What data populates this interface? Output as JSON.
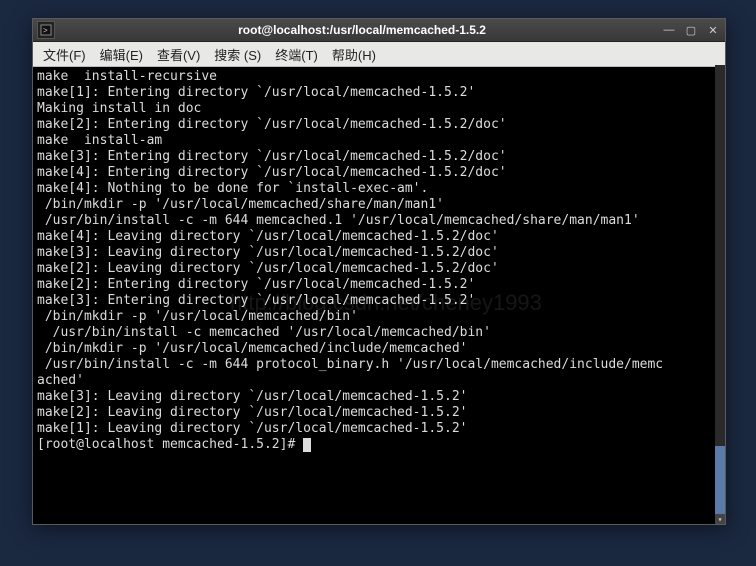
{
  "titlebar": {
    "title": "root@localhost:/usr/local/memcached-1.5.2"
  },
  "menubar": {
    "file": "文件(F)",
    "edit": "编辑(E)",
    "view": "查看(V)",
    "search": "搜索 (S)",
    "terminal": "终端(T)",
    "help": "帮助(H)"
  },
  "watermark": "http://blog.csdn.net/cheney1993",
  "terminal": {
    "lines": [
      "make  install-recursive",
      "make[1]: Entering directory `/usr/local/memcached-1.5.2'",
      "Making install in doc",
      "make[2]: Entering directory `/usr/local/memcached-1.5.2/doc'",
      "make  install-am",
      "make[3]: Entering directory `/usr/local/memcached-1.5.2/doc'",
      "make[4]: Entering directory `/usr/local/memcached-1.5.2/doc'",
      "make[4]: Nothing to be done for `install-exec-am'.",
      " /bin/mkdir -p '/usr/local/memcached/share/man/man1'",
      " /usr/bin/install -c -m 644 memcached.1 '/usr/local/memcached/share/man/man1'",
      "make[4]: Leaving directory `/usr/local/memcached-1.5.2/doc'",
      "make[3]: Leaving directory `/usr/local/memcached-1.5.2/doc'",
      "make[2]: Leaving directory `/usr/local/memcached-1.5.2/doc'",
      "make[2]: Entering directory `/usr/local/memcached-1.5.2'",
      "make[3]: Entering directory `/usr/local/memcached-1.5.2'",
      " /bin/mkdir -p '/usr/local/memcached/bin'",
      "  /usr/bin/install -c memcached '/usr/local/memcached/bin'",
      " /bin/mkdir -p '/usr/local/memcached/include/memcached'",
      " /usr/bin/install -c -m 644 protocol_binary.h '/usr/local/memcached/include/memc",
      "ached'",
      "make[3]: Leaving directory `/usr/local/memcached-1.5.2'",
      "make[2]: Leaving directory `/usr/local/memcached-1.5.2'",
      "make[1]: Leaving directory `/usr/local/memcached-1.5.2'"
    ],
    "prompt": "[root@localhost memcached-1.5.2]# "
  }
}
